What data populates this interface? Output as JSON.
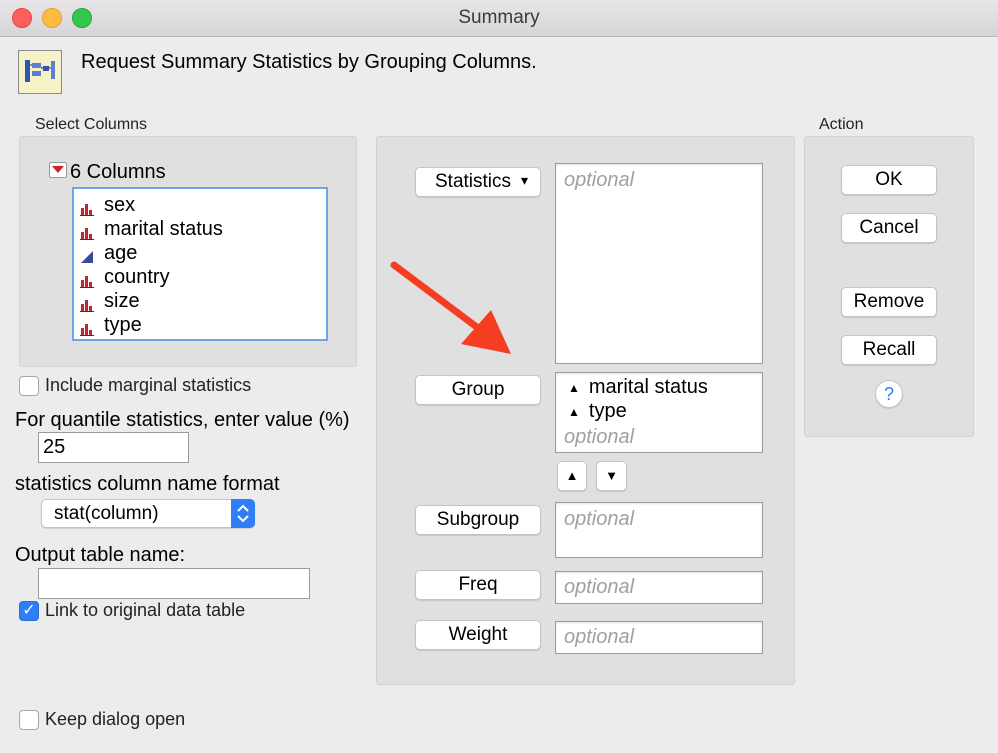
{
  "window": {
    "title": "Summary"
  },
  "header": {
    "text": "Request Summary Statistics by Grouping Columns."
  },
  "select_columns": {
    "label": "Select Columns",
    "count_label": "6 Columns",
    "items": [
      {
        "label": "sex",
        "icon": "nominal-bar-icon"
      },
      {
        "label": "marital status",
        "icon": "nominal-bar-icon"
      },
      {
        "label": "age",
        "icon": "continuous-triangle-icon"
      },
      {
        "label": "country",
        "icon": "nominal-bar-icon"
      },
      {
        "label": "size",
        "icon": "nominal-bar-icon"
      },
      {
        "label": "type",
        "icon": "nominal-bar-icon"
      }
    ]
  },
  "options": {
    "include_marginal": "Include marginal statistics",
    "quantile_label": "For quantile statistics, enter value (%)",
    "quantile_value": "25",
    "name_format_label": "statistics column name format",
    "name_format_value": "stat(column)",
    "output_name_label": "Output table name:",
    "output_name_value": "",
    "link_label": "Link to original data table",
    "keep_open_label": "Keep dialog open"
  },
  "roles": {
    "statistics": {
      "button": "Statistics",
      "placeholder": "optional"
    },
    "group": {
      "button": "Group",
      "items": [
        "marital status",
        "type"
      ],
      "placeholder": "optional"
    },
    "subgroup": {
      "button": "Subgroup",
      "placeholder": "optional"
    },
    "freq": {
      "button": "Freq",
      "placeholder": "optional"
    },
    "weight": {
      "button": "Weight",
      "placeholder": "optional"
    }
  },
  "action": {
    "label": "Action",
    "ok": "OK",
    "cancel": "Cancel",
    "remove": "Remove",
    "recall": "Recall",
    "help": "?"
  },
  "colors": {
    "accent": "#2f7ef5",
    "arrow": "#f53d22",
    "nominal_icon": "#c0282d",
    "continuous_icon": "#3a4a9a"
  }
}
